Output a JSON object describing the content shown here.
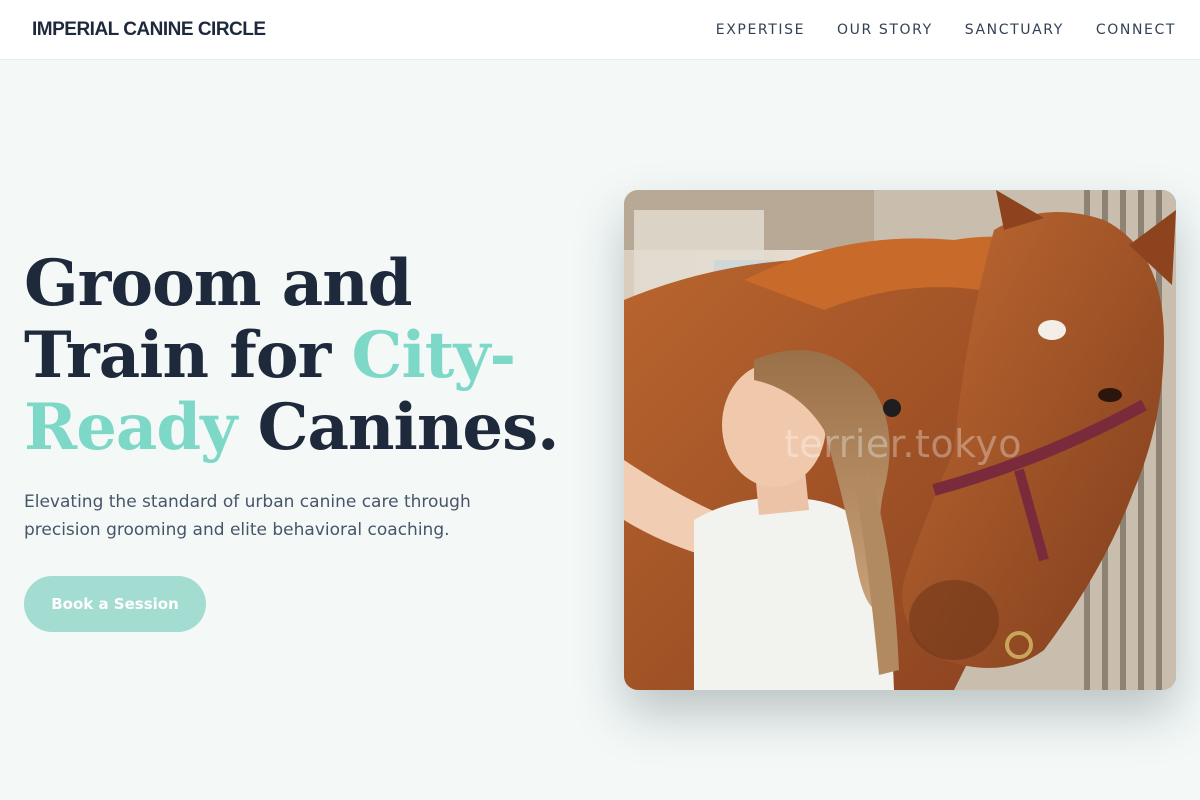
{
  "header": {
    "brand": "IMPERIAL CANINE CIRCLE",
    "nav": [
      {
        "label": "EXPERTISE"
      },
      {
        "label": "OUR STORY"
      },
      {
        "label": "SANCTUARY"
      },
      {
        "label": "CONNECT"
      }
    ]
  },
  "hero": {
    "title_part1": "Groom and Train for ",
    "title_accent1": "City-",
    "title_accent2": "Ready",
    "title_part2": " Canines.",
    "subtitle": "Elevating the standard of urban canine care through precision grooming and elite behavioral coaching.",
    "cta_label": "Book a Session",
    "image_watermark": "terrier.tokyo"
  },
  "colors": {
    "background": "#f4f9f8",
    "text": "#1e293b",
    "accent": "#7dd8c7",
    "button": "#a3dcd0"
  }
}
